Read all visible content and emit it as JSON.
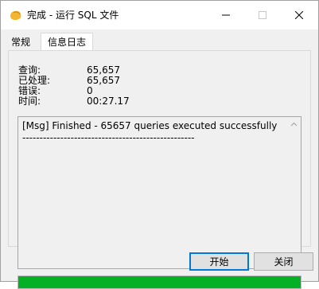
{
  "window": {
    "title": "完成 - 运行 SQL 文件",
    "icon": "navicat-app-icon",
    "controls": [
      "minimize-icon",
      "maximize-icon",
      "close-icon"
    ]
  },
  "tabs": [
    {
      "label": "常规",
      "active": false
    },
    {
      "label": "信息日志",
      "active": true
    }
  ],
  "info": {
    "query_label": "查询:",
    "query_value": "65,657",
    "processed_label": "已处理:",
    "processed_value": "65,657",
    "errors_label": "错误:",
    "errors_value": "0",
    "time_label": "时间:",
    "time_value": "00:27.17"
  },
  "log": {
    "lines": [
      "[Msg] Finished - 65657 queries executed successfully",
      "--------------------------------------------------"
    ]
  },
  "progress": {
    "value": 1.0,
    "color": "#06b025"
  },
  "buttons": {
    "start": "开始",
    "close": "关闭"
  }
}
